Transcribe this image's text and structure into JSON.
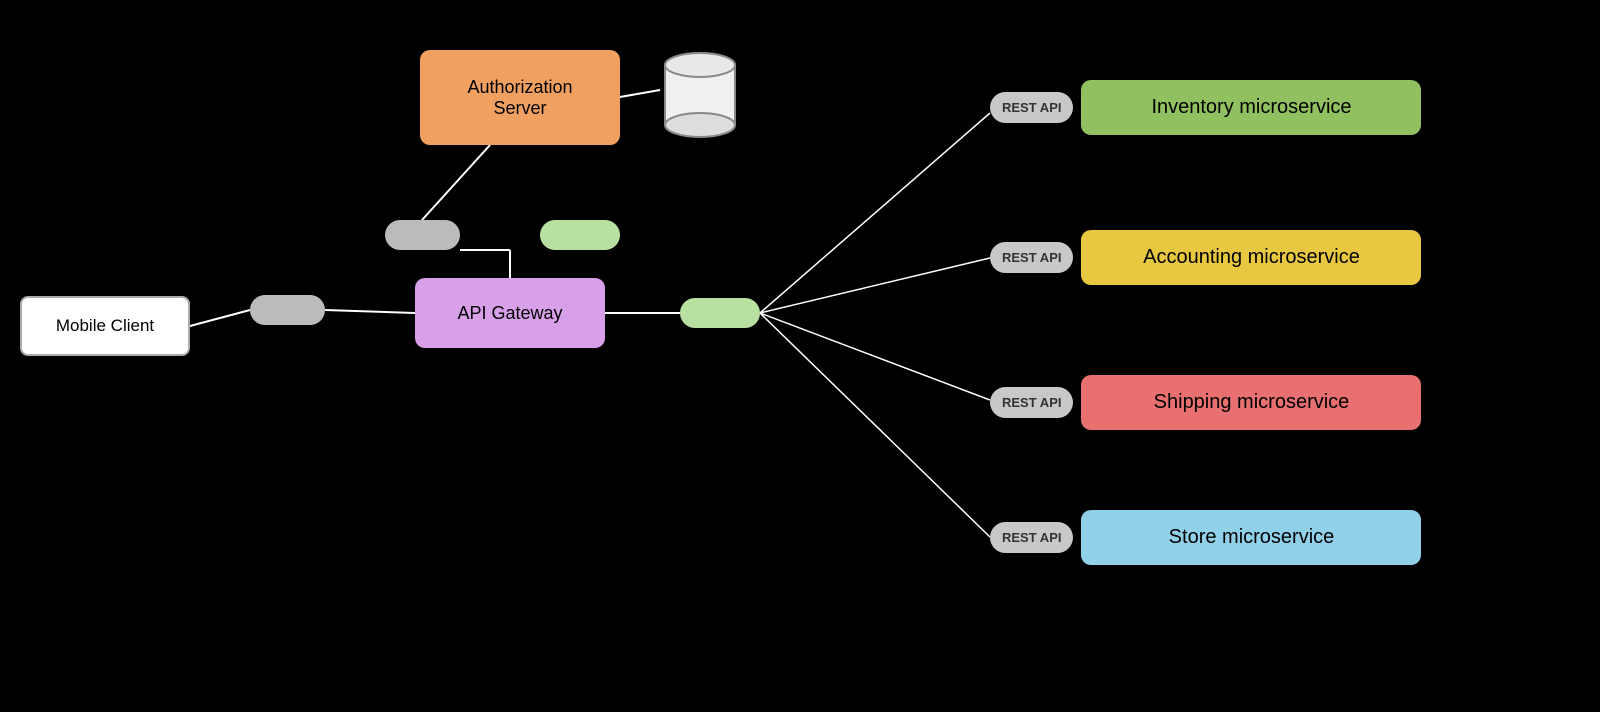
{
  "diagram": {
    "background": "#000000",
    "nodes": {
      "mobile_client": {
        "label": "Mobile Client"
      },
      "auth_server": {
        "label": "Authorization\nServer"
      },
      "api_gateway": {
        "label": "API Gateway"
      },
      "database": {
        "label": "DB"
      },
      "pill_gray_1": {
        "label": ""
      },
      "pill_green_1": {
        "label": ""
      },
      "pill_gray_2": {
        "label": ""
      },
      "pill_green_2": {
        "label": ""
      }
    },
    "microservices": [
      {
        "id": "inventory",
        "badge": "REST API",
        "label": "Inventory microservice",
        "color_class": "inventory"
      },
      {
        "id": "accounting",
        "badge": "REST API",
        "label": "Accounting microservice",
        "color_class": "accounting"
      },
      {
        "id": "shipping",
        "badge": "REST API",
        "label": "Shipping microservice",
        "color_class": "shipping"
      },
      {
        "id": "store",
        "badge": "REST API",
        "label": "Store microservice",
        "color_class": "store"
      }
    ]
  }
}
